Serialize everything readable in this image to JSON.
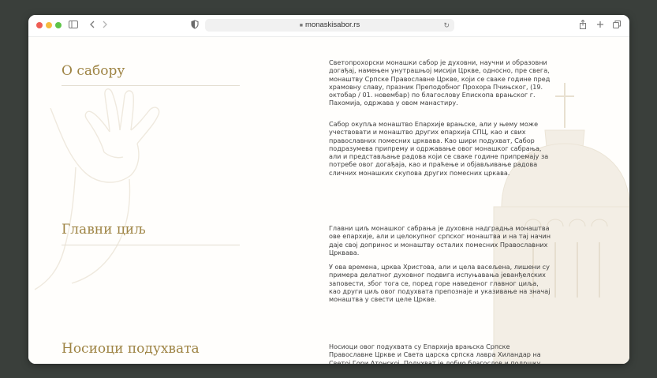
{
  "browser": {
    "url": "monaskisabor.rs",
    "icons": [
      "sidebar-icon",
      "back-icon",
      "forward-icon",
      "shield-icon",
      "lock-icon",
      "reload-icon",
      "share-icon",
      "new-tab-icon",
      "tabs-icon"
    ]
  },
  "sections": [
    {
      "title": "О сабору",
      "paragraphs": [
        "Светопрохорски монашки сабор је духовни, научни и образовни догађај, намењен унутрашњој мисији Цркве, односно, пре свега, монаштву Српске Православне Цркве, који се сваке године пред храмовну славу, празник Преподобног Прохора Пчињског, (19. октобар / 01. новембар) по благослову Епископа врањског г. Пахомија, одржава у овом манастиру.",
        "Сабор окупља монаштво Епархије врањске, али у њему може учествовати и монаштво других епархија СПЦ, као и свих православних помесних црквава. Као шири подухват, Сабор подразумева припрему и одржавање овог монашког сабрања, али и представљање радова који се сваке године припремају за потребе овог догађаја, као и праћење и објављивање радова сличних монашких скупова других помесних цркава."
      ]
    },
    {
      "title": "Главни циљ",
      "paragraphs": [
        "Главни циљ монашког сабрања је духовна надградња монаштва ове епархије, али и целокупног српског монаштва и на тај начин даје свој допринос и монаштву осталих помесних Православних Црквава.",
        "У ова времена, црква Христова, али и цела васељена, лишени су примера делатног духовног подвига испуњавања јеванђелских заповести, због тога се, поред горе наведеног главног циља, као други циљ овог подухвата препознаје и указивање на значај монаштва у свести целе Цркве."
      ]
    },
    {
      "title": "Носиоци подухвата",
      "paragraphs": [
        "Носиоци овог подухвата су Епархија врањска Српске Православне Цркве и Света царска српска лавра Хиландар на Светој Гори Атонској. Подухват је добио благослов и подршку Његове Светости Патријарха српског Г. Порфирија и Светог Архијерејског Синода Српске Православне Цркве."
      ]
    }
  ],
  "colors": {
    "heading": "#9e8444",
    "text": "#3e3e3e",
    "divider": "#e4ddd0",
    "watermark": "#efe9de"
  }
}
